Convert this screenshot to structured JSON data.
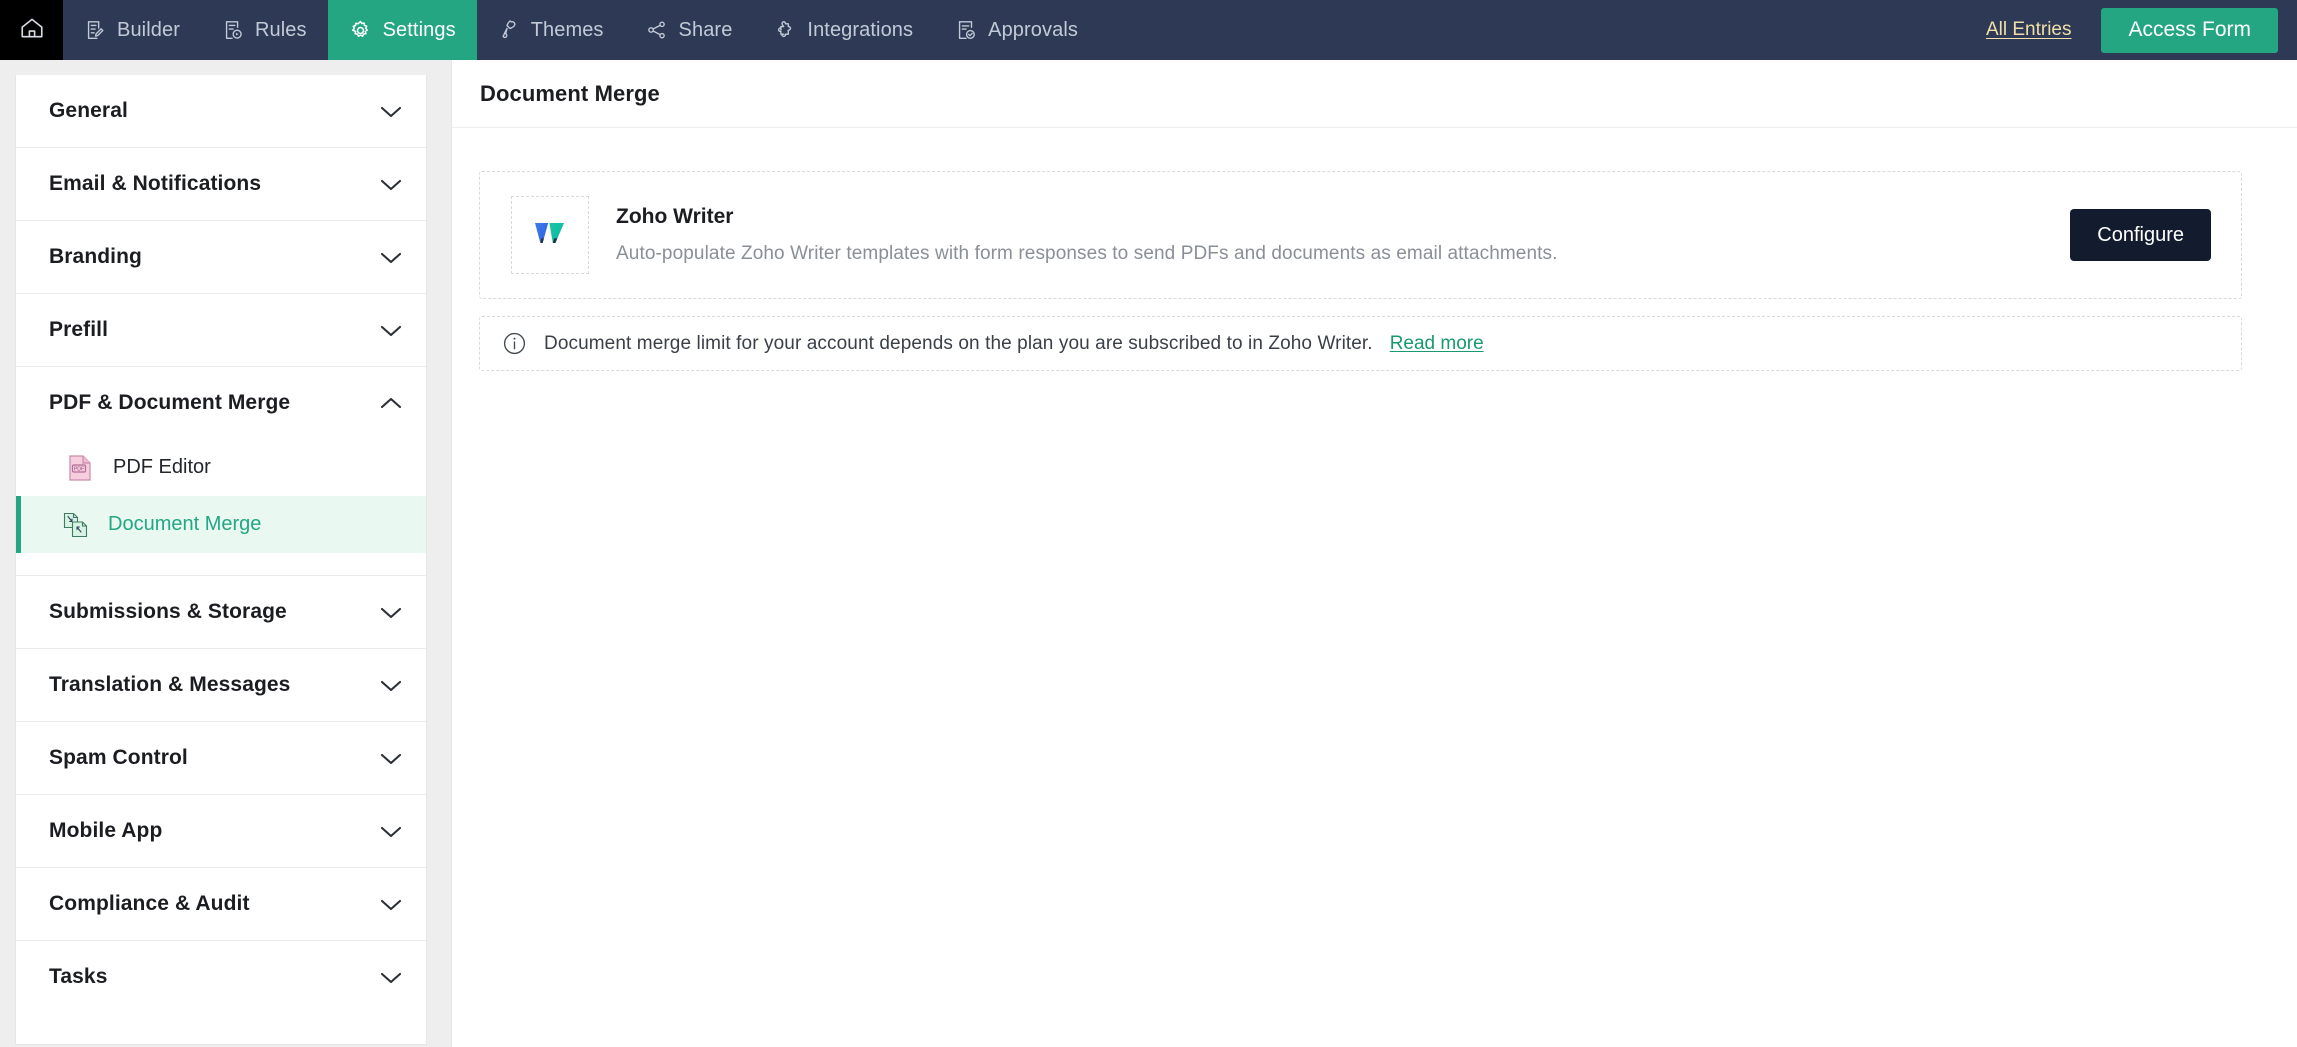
{
  "topnav": {
    "home_icon": "home-icon",
    "items": [
      {
        "label": "Builder",
        "icon": "form-builder-icon",
        "active": false
      },
      {
        "label": "Rules",
        "icon": "rules-icon",
        "active": false
      },
      {
        "label": "Settings",
        "icon": "gear-icon",
        "active": true
      },
      {
        "label": "Themes",
        "icon": "paint-roller-icon",
        "active": false
      },
      {
        "label": "Share",
        "icon": "share-nodes-icon",
        "active": false
      },
      {
        "label": "Integrations",
        "icon": "puzzle-piece-icon",
        "active": false
      },
      {
        "label": "Approvals",
        "icon": "approval-doc-icon",
        "active": false
      }
    ],
    "all_entries_label": "All Entries",
    "access_form_label": "Access Form",
    "colors": {
      "bar_bg": "#2e3a55",
      "home_bg": "#000000",
      "accent": "#24a683",
      "all_entries": "#f0dfa8"
    }
  },
  "sidebar": {
    "sections": [
      {
        "label": "General",
        "expanded": false
      },
      {
        "label": "Email & Notifications",
        "expanded": false
      },
      {
        "label": "Branding",
        "expanded": false
      },
      {
        "label": "Prefill",
        "expanded": false
      },
      {
        "label": "PDF & Document Merge",
        "expanded": true
      },
      {
        "label": "Submissions & Storage",
        "expanded": false
      },
      {
        "label": "Translation & Messages",
        "expanded": false
      },
      {
        "label": "Spam Control",
        "expanded": false
      },
      {
        "label": "Mobile App",
        "expanded": false
      },
      {
        "label": "Compliance & Audit",
        "expanded": false
      },
      {
        "label": "Tasks",
        "expanded": false
      }
    ],
    "pdf_subitems": [
      {
        "label": "PDF Editor",
        "icon": "pdf-file-icon",
        "selected": false
      },
      {
        "label": "Document Merge",
        "icon": "document-merge-icon",
        "selected": true
      }
    ],
    "selected_color": "#24a683"
  },
  "main": {
    "page_title": "Document Merge",
    "card": {
      "logo_icon": "zoho-writer-logo",
      "title": "Zoho Writer",
      "description": "Auto-populate Zoho Writer templates with form responses to send PDFs and documents as email attachments.",
      "button_label": "Configure"
    },
    "info": {
      "icon": "info-circle-icon",
      "text": "Document merge limit for your account depends on the plan you are subscribed to in Zoho Writer.",
      "link_label": "Read more",
      "link_color": "#18996f"
    }
  }
}
